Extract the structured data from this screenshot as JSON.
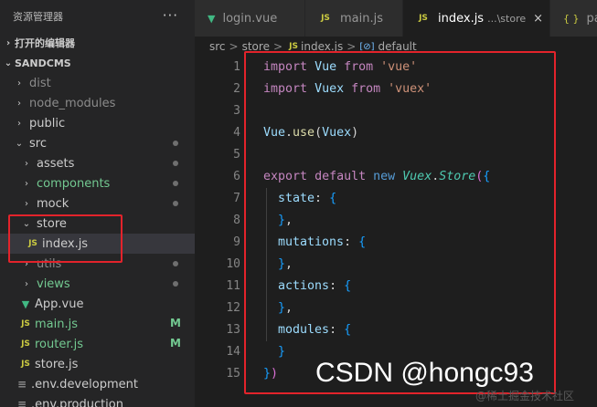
{
  "sidebar": {
    "title": "资源管理器",
    "more": "···",
    "open_editors": "打开的编辑器",
    "project": "SANDCMS",
    "items": [
      {
        "label": "dist",
        "kind": "folder",
        "open": false
      },
      {
        "label": "node_modules",
        "kind": "folder",
        "open": false
      },
      {
        "label": "public",
        "kind": "folder",
        "open": false
      },
      {
        "label": "src",
        "kind": "folder",
        "open": true
      },
      {
        "label": "assets",
        "kind": "folder",
        "open": false
      },
      {
        "label": "components",
        "kind": "folder",
        "open": false
      },
      {
        "label": "mock",
        "kind": "folder",
        "open": false
      },
      {
        "label": "store",
        "kind": "folder",
        "open": true
      },
      {
        "label": "index.js",
        "kind": "js"
      },
      {
        "label": "utils",
        "kind": "folder",
        "open": false
      },
      {
        "label": "views",
        "kind": "folder",
        "open": false
      },
      {
        "label": "App.vue",
        "kind": "vue"
      },
      {
        "label": "main.js",
        "kind": "js",
        "badge": "M"
      },
      {
        "label": "router.js",
        "kind": "js",
        "badge": "M"
      },
      {
        "label": "store.js",
        "kind": "js"
      },
      {
        "label": ".env.development",
        "kind": "env"
      },
      {
        "label": ".env.production",
        "kind": "env"
      }
    ]
  },
  "tabs": [
    {
      "label": "login.vue",
      "icon": "V"
    },
    {
      "label": "main.js",
      "icon": "JS"
    },
    {
      "label": "index.js",
      "icon": "JS",
      "suffix": "...\\store",
      "close": "×"
    },
    {
      "label": "pac",
      "icon": "{ }"
    }
  ],
  "breadcrumb": {
    "parts": [
      "src",
      "store",
      "index.js",
      "default"
    ],
    "separator": ">",
    "js_icon": "JS",
    "symbol_icon": "[⊘]"
  },
  "code": {
    "line_numbers": [
      "1",
      "2",
      "3",
      "4",
      "5",
      "6",
      "7",
      "8",
      "9",
      "10",
      "11",
      "12",
      "13",
      "14",
      "15"
    ]
  },
  "watermark": {
    "main": "CSDN @hongc93",
    "sub": "@稀土掘金技术社区"
  }
}
